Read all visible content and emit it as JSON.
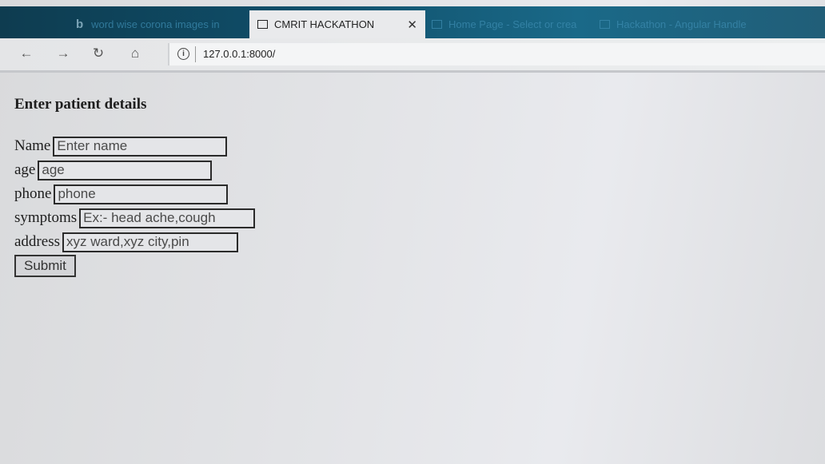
{
  "browser": {
    "tabs": [
      {
        "label": "word wise corona images in"
      },
      {
        "label": "CMRIT HACKATHON"
      },
      {
        "label": "Home Page - Select or crea"
      },
      {
        "label": "Hackathon - Angular Handle"
      }
    ],
    "address": {
      "url": "127.0.0.1:8000/"
    },
    "nav": {
      "back": "←",
      "forward": "→",
      "refresh": "↻",
      "home": "⌂"
    },
    "close_glyph": "✕",
    "bing_glyph": "b",
    "info_glyph": "i"
  },
  "form": {
    "title": "Enter patient details",
    "fields": [
      {
        "label": "Name",
        "placeholder": "Enter name"
      },
      {
        "label": "age",
        "placeholder": "age"
      },
      {
        "label": "phone",
        "placeholder": "phone"
      },
      {
        "label": "symptoms",
        "placeholder": "Ex:- head ache,cough"
      },
      {
        "label": "address",
        "placeholder": "xyz ward,xyz city,pin"
      }
    ],
    "submit_label": "Submit"
  },
  "colors": {
    "tabstrip": "#0f4d68",
    "page_bg": "#e2e3e6",
    "field_border": "#2a2a2a"
  }
}
